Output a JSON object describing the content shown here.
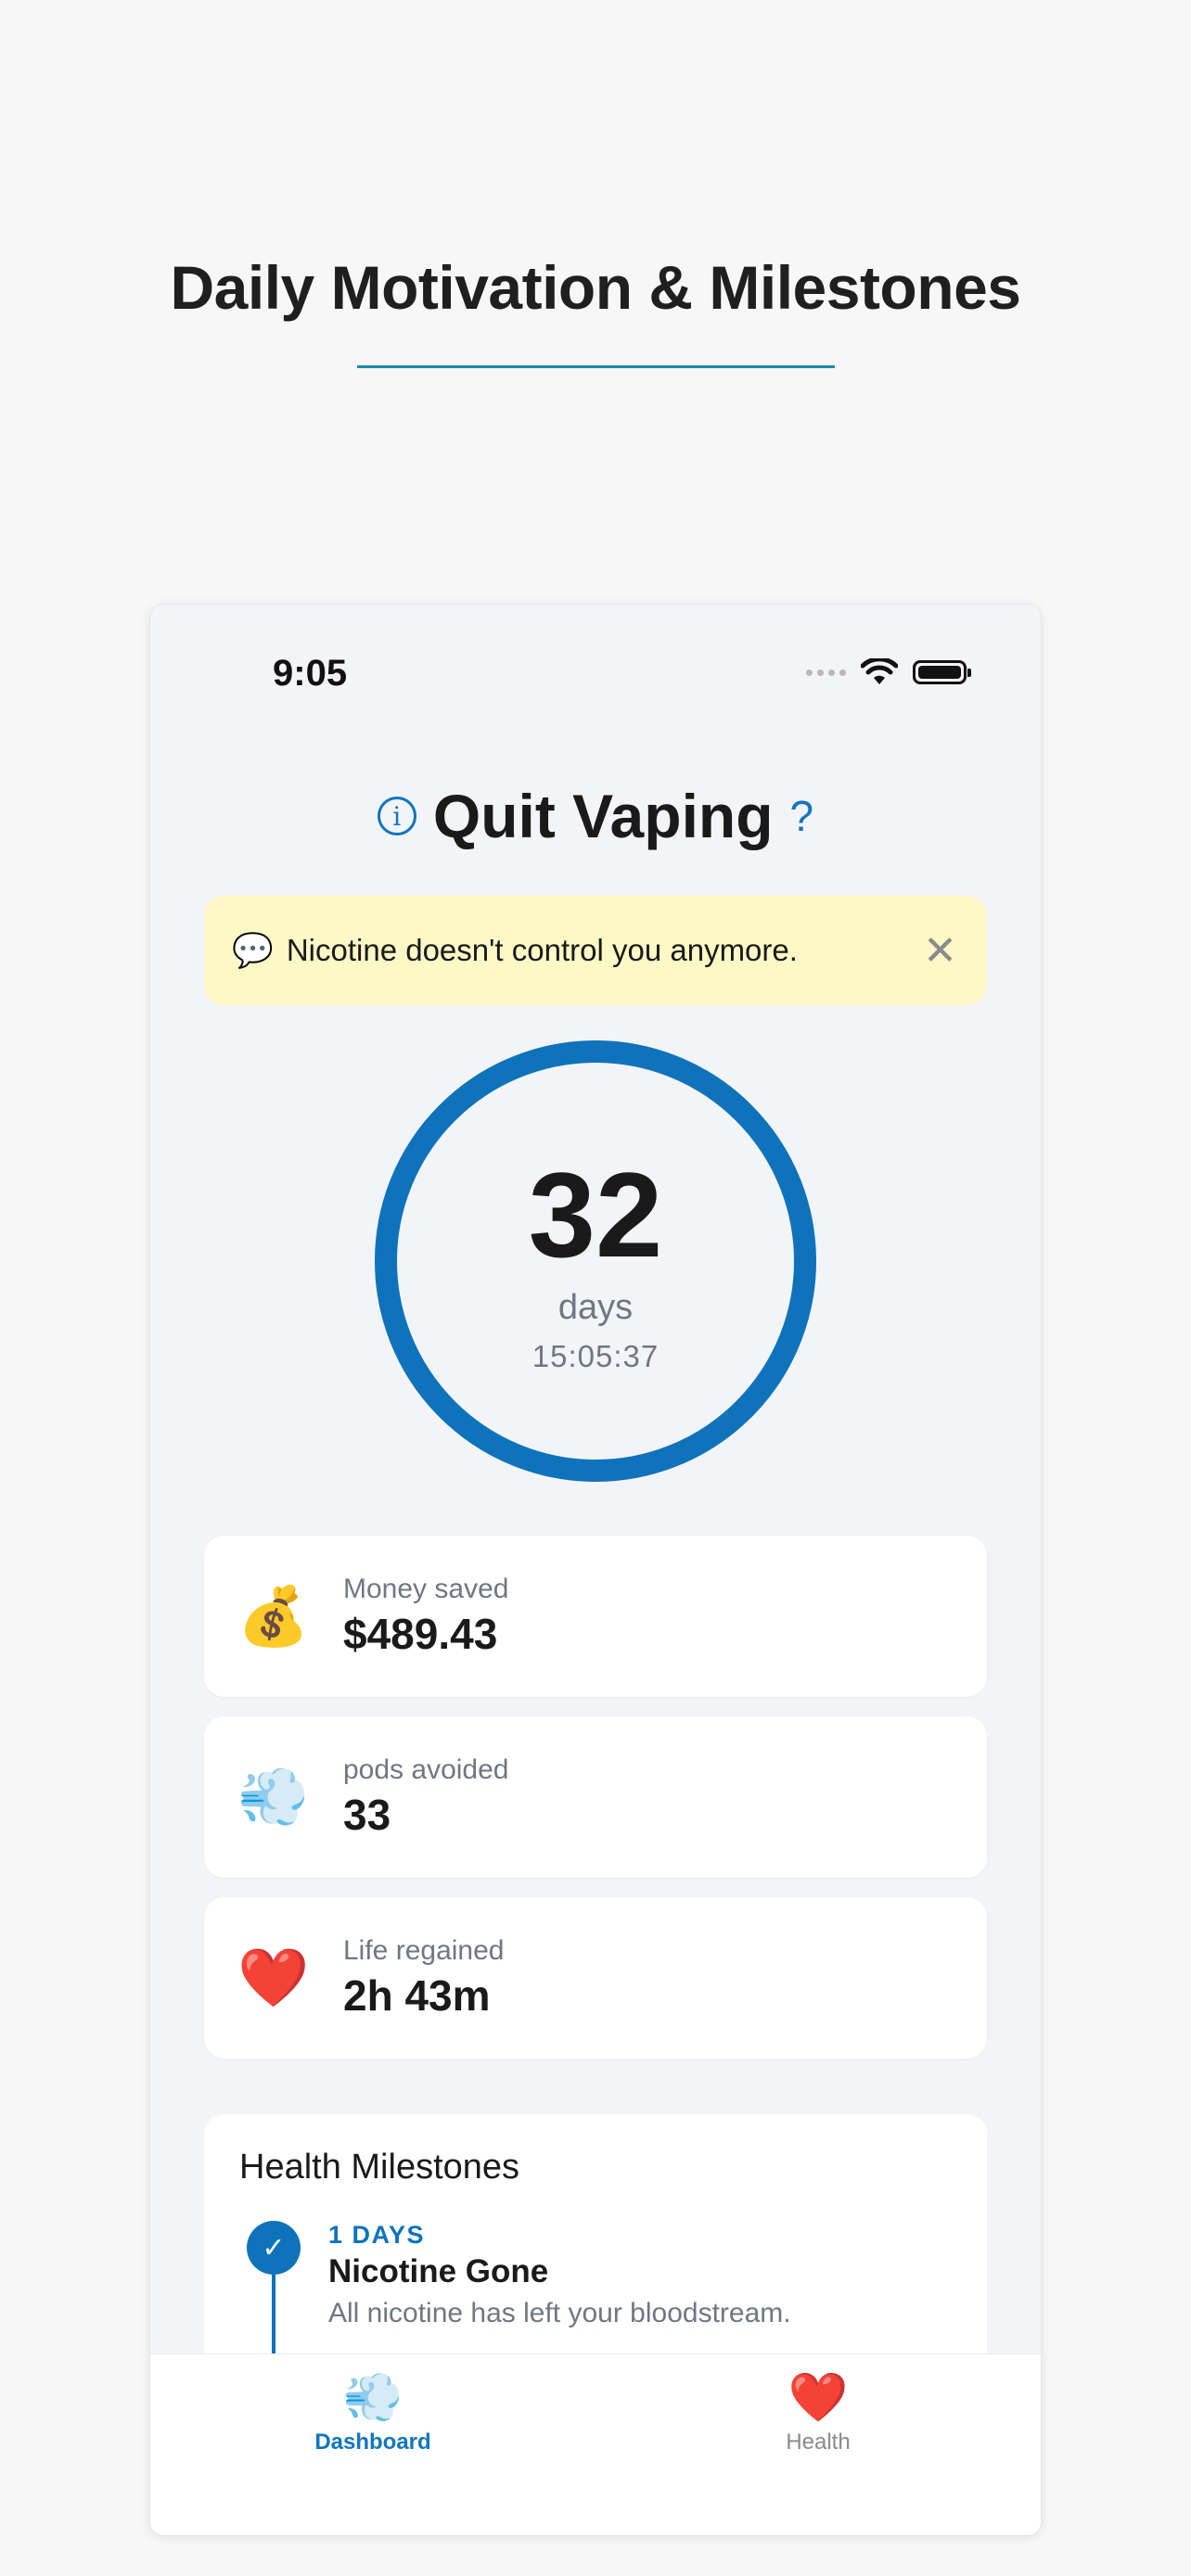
{
  "page": {
    "title": "Daily Motivation & Milestones"
  },
  "status_bar": {
    "time": "9:05"
  },
  "header": {
    "info_glyph": "i",
    "title": "Quit Vaping",
    "help_glyph": "?"
  },
  "banner": {
    "icon": "💬",
    "text": "Nicotine doesn't control you anymore.",
    "close_glyph": "✕"
  },
  "counter": {
    "days": "32",
    "days_label": "days",
    "elapsed": "15:05:37"
  },
  "stats": [
    {
      "icon": "💰",
      "label": "Money saved",
      "value": "$489.43"
    },
    {
      "icon": "💨",
      "label": "pods avoided",
      "value": "33"
    },
    {
      "icon": "❤️",
      "label": "Life regained",
      "value": "2h 43m"
    }
  ],
  "milestones": {
    "title": "Health Milestones",
    "items": [
      {
        "check_glyph": "✓",
        "tag": "1 DAYS",
        "name": "Nicotine Gone",
        "description": "All nicotine has left your bloodstream."
      }
    ]
  },
  "tabs": [
    {
      "icon": "💨",
      "label": "Dashboard",
      "active": true
    },
    {
      "icon": "❤️",
      "label": "Health",
      "active": false
    }
  ],
  "colors": {
    "accent": "#0e73bb",
    "banner_bg": "#fef8c6",
    "underline": "#1f8aa6"
  }
}
